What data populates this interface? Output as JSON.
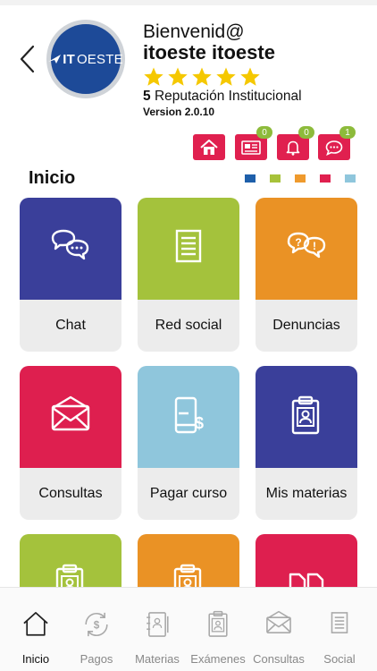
{
  "header": {
    "logo_text_bold": "IT",
    "logo_text_light": "OESTE",
    "welcome": "Bienvenid@",
    "username": "itoeste itoeste",
    "stars": 5,
    "rating_value": "5",
    "rating_label": "Reputación Institucional",
    "version": "Version 2.0.10"
  },
  "header_buttons": [
    {
      "name": "home",
      "icon": "home-icon",
      "badge": null
    },
    {
      "name": "news",
      "icon": "newspaper-icon",
      "badge": "0"
    },
    {
      "name": "notifications",
      "icon": "bell-icon",
      "badge": "0"
    },
    {
      "name": "messages",
      "icon": "chat-bubble-icon",
      "badge": "1"
    }
  ],
  "section": {
    "title": "Inicio",
    "legend_colors": [
      "#1e5faa",
      "#a7c23a",
      "#ef9a2d",
      "#e0204f",
      "#8fc6dc"
    ]
  },
  "tiles": [
    {
      "label": "Chat",
      "color": "#3a3f9a",
      "icon": "chat-bubbles-icon"
    },
    {
      "label": "Red social",
      "color": "#a4c23c",
      "icon": "document-icon"
    },
    {
      "label": "Denuncias",
      "color": "#ea9225",
      "icon": "report-bubbles-icon"
    },
    {
      "label": "Consultas",
      "color": "#de1f4f",
      "icon": "envelope-icon"
    },
    {
      "label": "Pagar curso",
      "color": "#8fc6dc",
      "icon": "phone-payment-icon"
    },
    {
      "label": "Mis materias",
      "color": "#3a3f9a",
      "icon": "clipboard-badge-icon"
    },
    {
      "label": "",
      "color": "#a4c23c",
      "icon": "clipboard-badge-icon"
    },
    {
      "label": "",
      "color": "#ea9225",
      "icon": "clipboard-badge-icon"
    },
    {
      "label": "",
      "color": "#de1f4f",
      "icon": "documents-icon"
    }
  ],
  "nav": [
    {
      "label": "Inicio",
      "icon": "home-icon",
      "active": true
    },
    {
      "label": "Pagos",
      "icon": "payment-cycle-icon",
      "active": false
    },
    {
      "label": "Materias",
      "icon": "notebook-icon",
      "active": false
    },
    {
      "label": "Exámenes",
      "icon": "badge-clipboard-icon",
      "active": false
    },
    {
      "label": "Consultas",
      "icon": "envelope-icon",
      "active": false
    },
    {
      "label": "Social",
      "icon": "document-icon",
      "active": false
    }
  ]
}
